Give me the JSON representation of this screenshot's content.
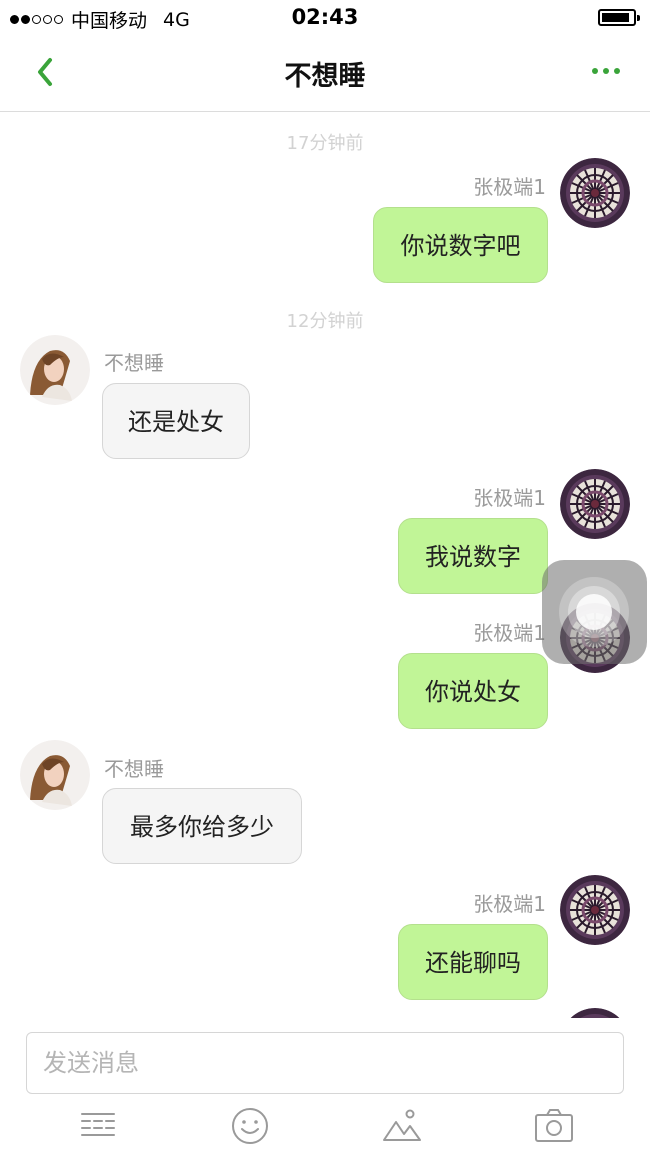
{
  "status_bar": {
    "carrier": "中国移动",
    "network": "4G",
    "time": "02:43"
  },
  "nav": {
    "title": "不想睡"
  },
  "messages": [
    {
      "type": "timestamp",
      "text": "17分钟前"
    },
    {
      "type": "outgoing",
      "sender": "张极端1",
      "text": "你说数字吧"
    },
    {
      "type": "timestamp",
      "text": "12分钟前"
    },
    {
      "type": "incoming",
      "sender": "不想睡",
      "text": "还是处女"
    },
    {
      "type": "outgoing",
      "sender": "张极端1",
      "text": "我说数字"
    },
    {
      "type": "outgoing",
      "sender": "张极端1",
      "text": "你说处女"
    },
    {
      "type": "incoming",
      "sender": "不想睡",
      "text": "最多你给多少"
    },
    {
      "type": "outgoing",
      "sender": "张极端1",
      "text": "还能聊吗"
    }
  ],
  "input": {
    "placeholder": "发送消息"
  },
  "toolbar": {
    "icons": [
      "menu-icon",
      "emoji-icon",
      "image-icon",
      "camera-icon"
    ]
  },
  "colors": {
    "accent": "#3aa43a",
    "outgoing_bubble": "#c1f597",
    "incoming_bubble": "#f5f5f5"
  }
}
